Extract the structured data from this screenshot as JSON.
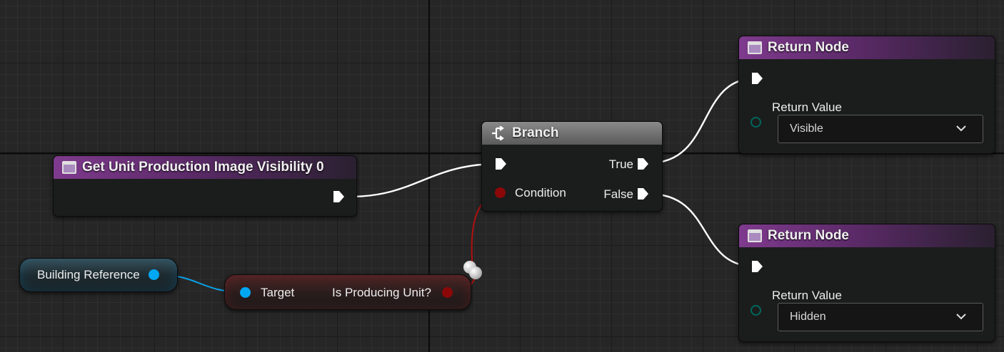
{
  "nodes": {
    "get_visibility": {
      "title": "Get Unit Production Image Visibility 0"
    },
    "branch": {
      "title": "Branch",
      "condition_label": "Condition",
      "true_label": "True",
      "false_label": "False"
    },
    "return_top": {
      "title": "Return Node",
      "value_label": "Return Value",
      "value": "Visible"
    },
    "return_bottom": {
      "title": "Return Node",
      "value_label": "Return Value",
      "value": "Hidden"
    },
    "building_reference": {
      "label": "Building Reference"
    },
    "is_producing": {
      "target_label": "Target",
      "output_label": "Is Producing Unit?"
    }
  },
  "colors": {
    "exec_pin": "#ffffff",
    "object_pin": "#00a8f4",
    "bool_pin": "#8c0808",
    "enum_pin": "#00665b",
    "function_header": "#7f3a8d"
  }
}
